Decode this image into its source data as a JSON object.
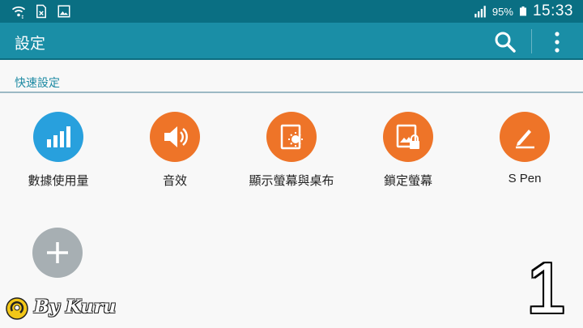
{
  "statusbar": {
    "icons_left": [
      "wifi-icon",
      "sim-card-icon",
      "gallery-icon"
    ],
    "signal_icon": "signal-icon",
    "battery_percent": "95%",
    "battery_icon": "battery-icon",
    "time": "15:33"
  },
  "actionbar": {
    "title": "設定",
    "search_icon": "search-icon",
    "more_icon": "more-vert-icon"
  },
  "section": {
    "label": "快速設定"
  },
  "tiles": [
    {
      "label": "數據使用量",
      "icon": "data-usage-icon",
      "color": "#28a0dd"
    },
    {
      "label": "音效",
      "icon": "volume-icon",
      "color": "#ee7428"
    },
    {
      "label": "顯示螢幕與桌布",
      "icon": "display-icon",
      "color": "#ee7428"
    },
    {
      "label": "鎖定螢幕",
      "icon": "lock-screen-icon",
      "color": "#ee7428"
    },
    {
      "label": "S Pen",
      "icon": "s-pen-icon",
      "color": "#ee7428"
    }
  ],
  "add_button": {
    "icon": "plus-icon",
    "color": "#a7afb3"
  },
  "overlay": {
    "watermark": "By Kuru",
    "page_number": "1"
  },
  "colors": {
    "statusbar": "#0a6f83",
    "actionbar": "#1a8ea6",
    "accent": "#1d8aa3"
  }
}
